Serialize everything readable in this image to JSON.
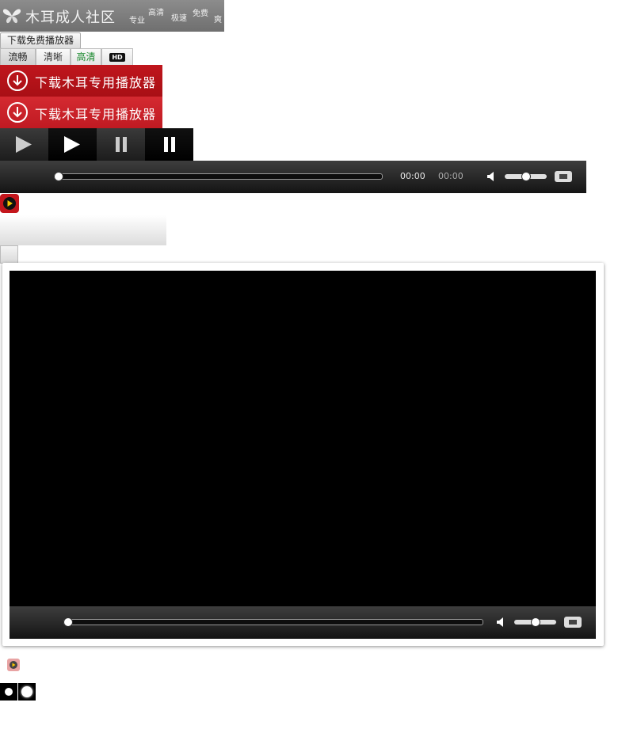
{
  "logo": {
    "title": "木耳成人社区",
    "tags": [
      "专业",
      "高清",
      "极速",
      "免费",
      "爽"
    ]
  },
  "download_small": {
    "label": "下载免费播放器"
  },
  "quality_tabs": [
    {
      "label": "流畅",
      "state": "selected"
    },
    {
      "label": "清晰",
      "state": "normal"
    },
    {
      "label": "高清",
      "state": "highlight"
    },
    {
      "label": "HD",
      "state": "badge"
    }
  ],
  "red_download_buttons": [
    {
      "label": "下载木耳专用播放器",
      "color": "#b8141b"
    },
    {
      "label": "下载木耳专用播放器",
      "color": "#d0212a"
    }
  ],
  "control_bar_top": {
    "current_time": "00:00",
    "total_time": "00:00",
    "progress": 0,
    "volume": 0.5
  },
  "player": {
    "progress": 0,
    "volume": 0.5
  },
  "colors": {
    "accent_red": "#c4161c",
    "player_bg": "#000000",
    "highlight_green": "#1b8a2f"
  },
  "icons": [
    "butterfly-icon",
    "download-icon",
    "play-icon",
    "pause-icon",
    "volume-icon",
    "fullscreen-icon"
  ]
}
